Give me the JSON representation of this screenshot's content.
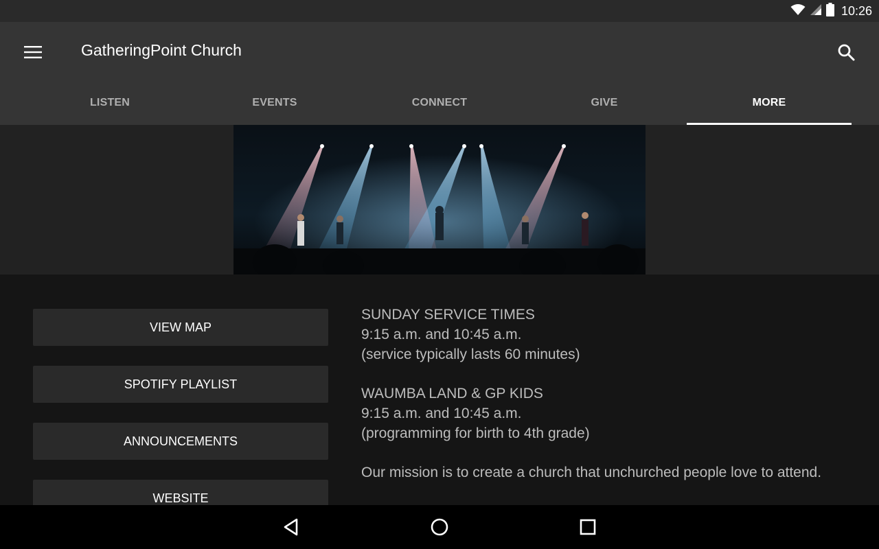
{
  "status_bar": {
    "time": "10:26",
    "icons": [
      "wifi-icon",
      "signal-icon",
      "battery-icon"
    ]
  },
  "app_bar": {
    "title": "GatheringPoint Church",
    "menu_icon": "menu-icon",
    "search_icon": "search-icon"
  },
  "tabs": [
    {
      "label": "LISTEN",
      "active": false
    },
    {
      "label": "EVENTS",
      "active": false
    },
    {
      "label": "CONNECT",
      "active": false
    },
    {
      "label": "GIVE",
      "active": false
    },
    {
      "label": "MORE",
      "active": true
    }
  ],
  "buttons": {
    "view_map": "VIEW MAP",
    "spotify_playlist": "SPOTIFY PLAYLIST",
    "announcements": "ANNOUNCEMENTS",
    "website": "WEBSITE"
  },
  "info": {
    "sunday": {
      "heading": "SUNDAY SERVICE TIMES",
      "times": "9:15 a.m. and 10:45 a.m.",
      "note": "(service typically lasts 60 minutes)"
    },
    "kids": {
      "heading": "WAUMBA LAND & GP KIDS",
      "times": "9:15 a.m. and 10:45 a.m.",
      "note": "(programming for birth to 4th grade)"
    },
    "mission": "Our mission is to create a church that unchurched people love to attend."
  },
  "nav_bar": {
    "icons": [
      "back-icon",
      "home-icon",
      "recents-icon"
    ]
  },
  "colors": {
    "status_bar": "#2a2a2a",
    "app_bar": "#353535",
    "hero_band": "#222222",
    "content_bg": "#151515",
    "button_bg": "#2a2a2a",
    "tab_inactive": "#b0b0b0",
    "tab_active": "#ffffff",
    "info_text": "#bdbdbd"
  }
}
